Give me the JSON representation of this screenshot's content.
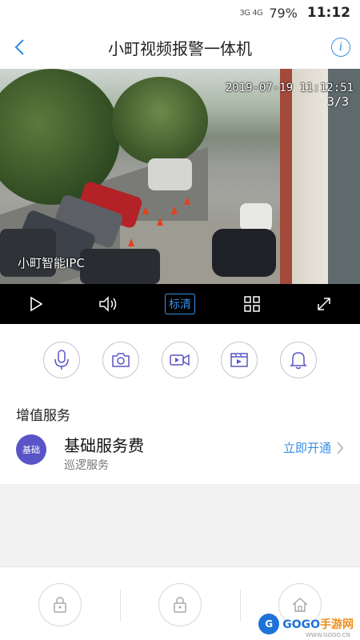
{
  "status_bar": {
    "network": "3G 4G",
    "battery": "79%",
    "time": "11:12"
  },
  "nav": {
    "title": "小町视频报警一体机",
    "back_icon": "chevron-left-icon",
    "info_icon": "info-icon",
    "info_glyph": "i"
  },
  "video": {
    "timestamp": "2019-07-19 11:12:51",
    "counter": "3/3",
    "watermark": "小町智能IPC"
  },
  "controls": {
    "quality_label": "标清",
    "icons": [
      "play-icon",
      "volume-icon",
      "grid-icon",
      "fullscreen-icon"
    ]
  },
  "actions": {
    "icons": [
      "microphone-icon",
      "camera-icon",
      "video-record-icon",
      "playback-icon",
      "bell-icon"
    ]
  },
  "value_added": {
    "section_title": "增值服务",
    "service": {
      "badge": "基础",
      "name": "基础服务费",
      "subtitle": "巡逻服务",
      "link": "立即开通"
    }
  },
  "bottom_bar": {
    "icons": [
      "lock-icon",
      "lock-icon",
      "home-icon"
    ],
    "logo_badge": "G",
    "logo_text": "GOGO",
    "logo_suffix": "手游网",
    "logo_url": "WWW.GOGO.CN"
  },
  "colors": {
    "accent": "#3a8ee6",
    "badge": "#5a55c7"
  }
}
